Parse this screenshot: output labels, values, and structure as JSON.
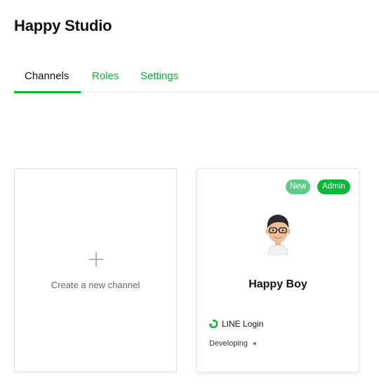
{
  "provider": {
    "name": "Happy Studio"
  },
  "tabs": [
    {
      "label": "Channels",
      "active": true
    },
    {
      "label": "Roles",
      "active": false
    },
    {
      "label": "Settings",
      "active": false
    }
  ],
  "create_card": {
    "icon": "plus-icon",
    "label": "Create a new channel"
  },
  "channel_card": {
    "badges": {
      "new": "New",
      "admin": "Admin"
    },
    "avatar": "avatar-icon",
    "name": "Happy Boy",
    "channel_type": {
      "icon": "line-login-icon",
      "label": "LINE Login"
    },
    "status": {
      "label": "Developing",
      "dot_color": "#4a7bd8"
    }
  },
  "colors": {
    "accent": "#06b52f",
    "badge_new": "#5fcb86",
    "badge_admin": "#08b937"
  }
}
